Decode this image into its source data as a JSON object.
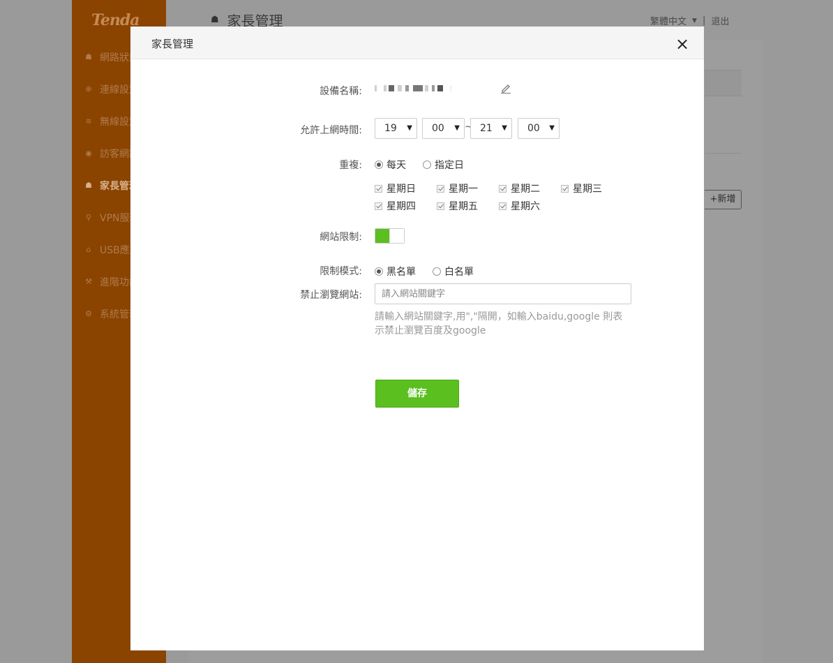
{
  "background": {
    "logo": "Tenda",
    "sidebar_items": [
      {
        "label": "網路狀態",
        "icon": "network-status-icon"
      },
      {
        "label": "連線設定",
        "icon": "globe-icon"
      },
      {
        "label": "無線設定",
        "icon": "wifi-icon"
      },
      {
        "label": "訪客網路",
        "icon": "guest-icon"
      },
      {
        "label": "家長管理",
        "icon": "parental-icon",
        "active": true
      },
      {
        "label": "VPN服務",
        "icon": "vpn-icon"
      },
      {
        "label": "USB應用",
        "icon": "usb-icon"
      },
      {
        "label": "進階功能",
        "icon": "tools-icon"
      },
      {
        "label": "系統管理",
        "icon": "settings-icon"
      }
    ],
    "page_title": "家長管理",
    "language": "繁體中文",
    "separator": "|",
    "logout": "退出",
    "add_button": "+新增"
  },
  "modal": {
    "title": "家長管理",
    "close_icon": "×",
    "device_name_label": "設備名稱:",
    "time_label": "允許上網時間:",
    "time": {
      "start_hour": "19",
      "start_minute": "00",
      "separator": "~",
      "end_hour": "21",
      "end_minute": "00"
    },
    "repeat_label": "重複:",
    "repeat_options": [
      {
        "label": "每天",
        "selected": true
      },
      {
        "label": "指定日",
        "selected": false
      }
    ],
    "days": [
      {
        "label": "星期日",
        "checked": true
      },
      {
        "label": "星期一",
        "checked": true
      },
      {
        "label": "星期二",
        "checked": true
      },
      {
        "label": "星期三",
        "checked": true
      },
      {
        "label": "星期四",
        "checked": true
      },
      {
        "label": "星期五",
        "checked": true
      },
      {
        "label": "星期六",
        "checked": true
      }
    ],
    "website_limit_label": "網站限制:",
    "website_limit_enabled": true,
    "mode_label": "限制模式:",
    "mode_options": [
      {
        "label": "黑名單",
        "selected": true
      },
      {
        "label": "白名單",
        "selected": false
      }
    ],
    "blocked_label": "禁止瀏覽網站:",
    "blocked_placeholder": "請入網站關鍵字",
    "hint": "請輸入網站關鍵字,用\",\"隔開，如輸入baidu,google 則表示禁止瀏覽百度及google",
    "save_label": "儲存"
  },
  "colors": {
    "accent": "#5bbf1f",
    "sidebar": "#8a4400"
  }
}
